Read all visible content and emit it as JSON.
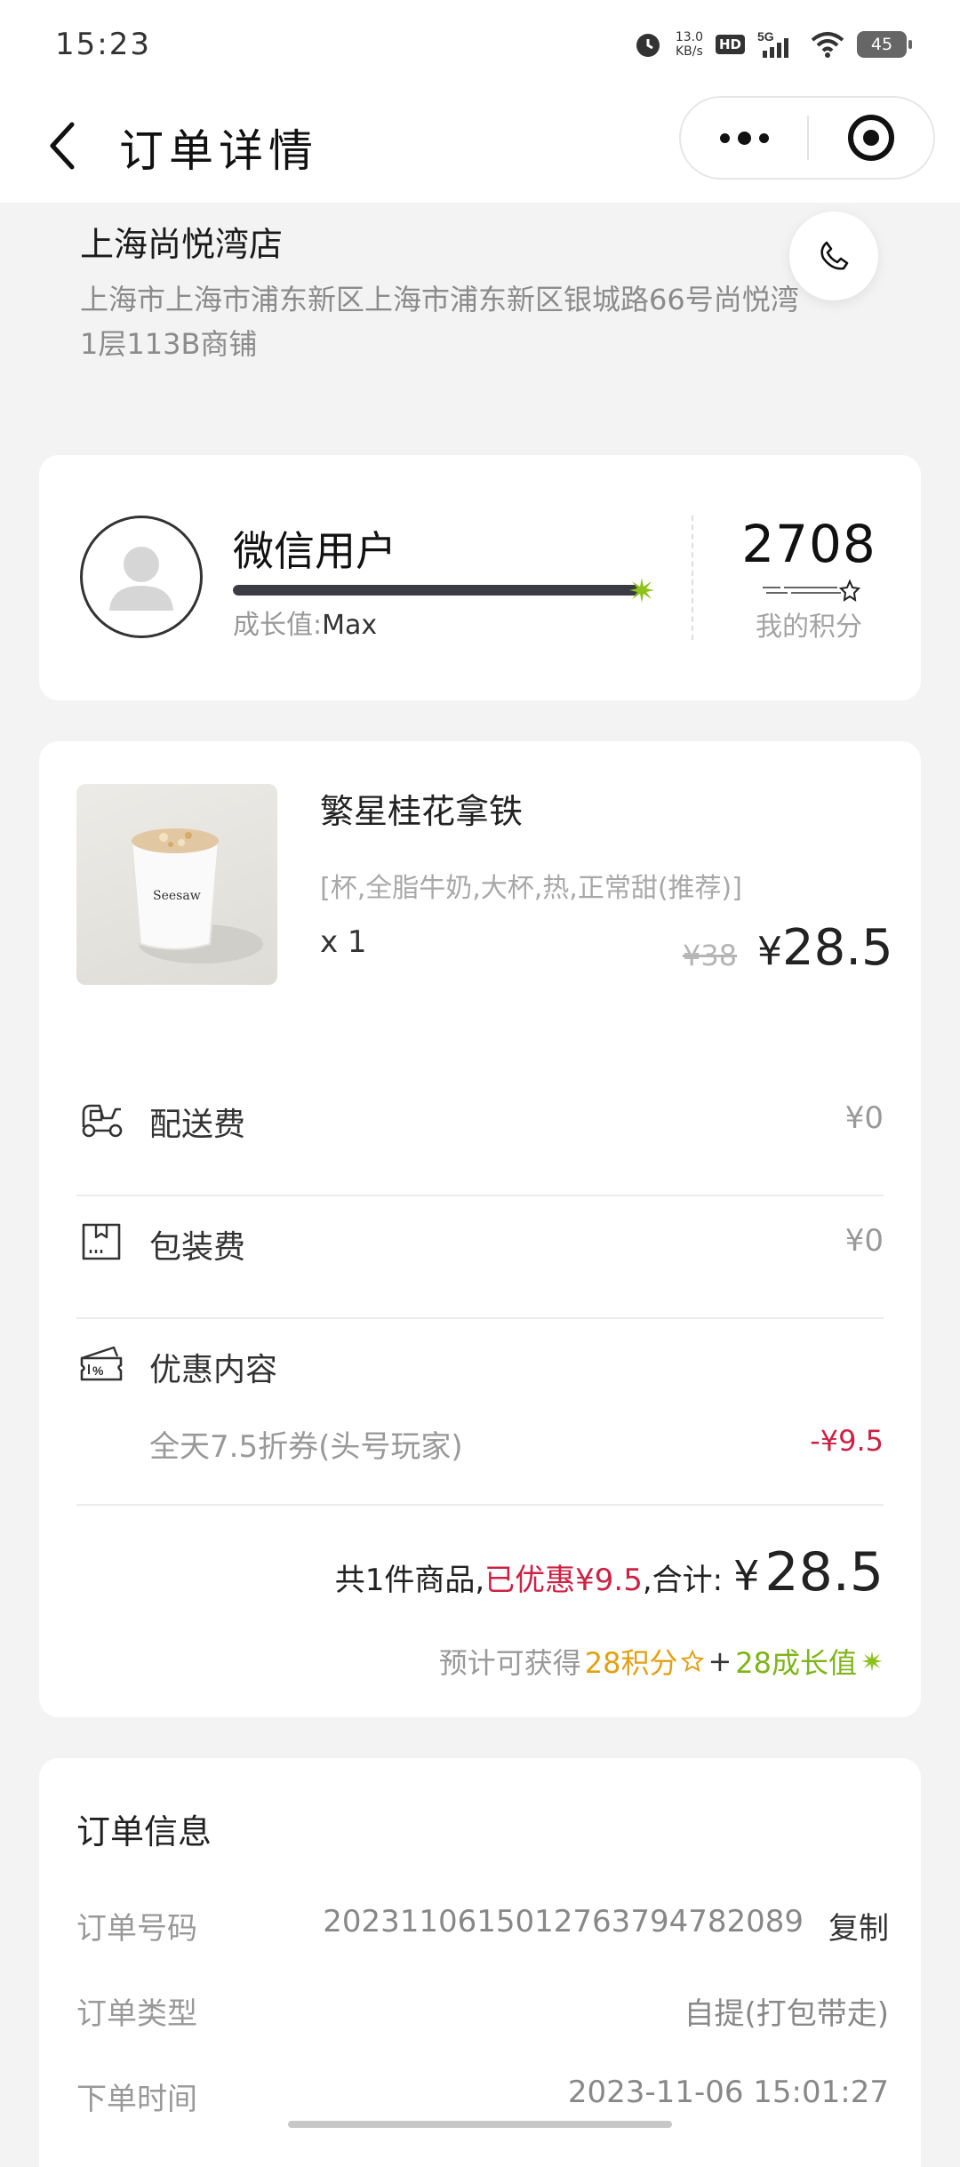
{
  "status_bar": {
    "time": "15:23",
    "speed_value": "13.0",
    "speed_unit": "KB/s",
    "hd": "HD",
    "network": "5G",
    "battery": "45"
  },
  "nav": {
    "title": "订单详情"
  },
  "store": {
    "name": "上海尚悦湾店",
    "address": "上海市上海市浦东新区上海市浦东新区银城路66号尚悦湾1层113B商铺"
  },
  "member": {
    "name": "微信用户",
    "growth_label": "成长值:",
    "growth_value": "Max",
    "growth_progress": 1.0,
    "points": "2708",
    "points_label": "我的积分"
  },
  "product": {
    "name": "繁星桂花拿铁",
    "spec": "[杯,全脂牛奶,大杯,热,正常甜(推荐)]",
    "qty": "x 1",
    "original_price": "¥38",
    "price_symbol": "¥",
    "price": "28.5",
    "cup_text": "Seesaw"
  },
  "fees": {
    "delivery_label": "配送费",
    "delivery_value": "¥0",
    "packing_label": "包装费",
    "packing_value": "¥0",
    "discount_label": "优惠内容",
    "discount_detail": "全天7.5折券(头号玩家)",
    "discount_value": "-¥9.5"
  },
  "summary": {
    "count_text": "共1件商品,",
    "saved_text": "已优惠¥9.5",
    "total_label": ",合计:",
    "total_symbol": "¥",
    "total_amount": "28.5",
    "earn_prefix": "预计可获得",
    "earn_points": "28积分",
    "plus": "+",
    "earn_growth": "28成长值"
  },
  "order_info": {
    "title": "订单信息",
    "number_label": "订单号码",
    "number_value": "20231106150127637947820​89",
    "copy_label": "复制",
    "type_label": "订单类型",
    "type_value": "自提(打包带走)",
    "time_label": "下单时间",
    "time_value": "2023-11-06 15:01:27"
  },
  "colors": {
    "discount_red": "#cc2244",
    "points_gold": "#e1a112",
    "growth_green": "#7fb517",
    "bar_dark": "#3a3b45"
  },
  "icons": [
    "back-arrow-icon",
    "more-icon",
    "target-icon",
    "phone-icon",
    "avatar-icon",
    "growth-star-icon",
    "points-star-icon",
    "scooter-icon",
    "package-icon",
    "coupon-icon"
  ]
}
